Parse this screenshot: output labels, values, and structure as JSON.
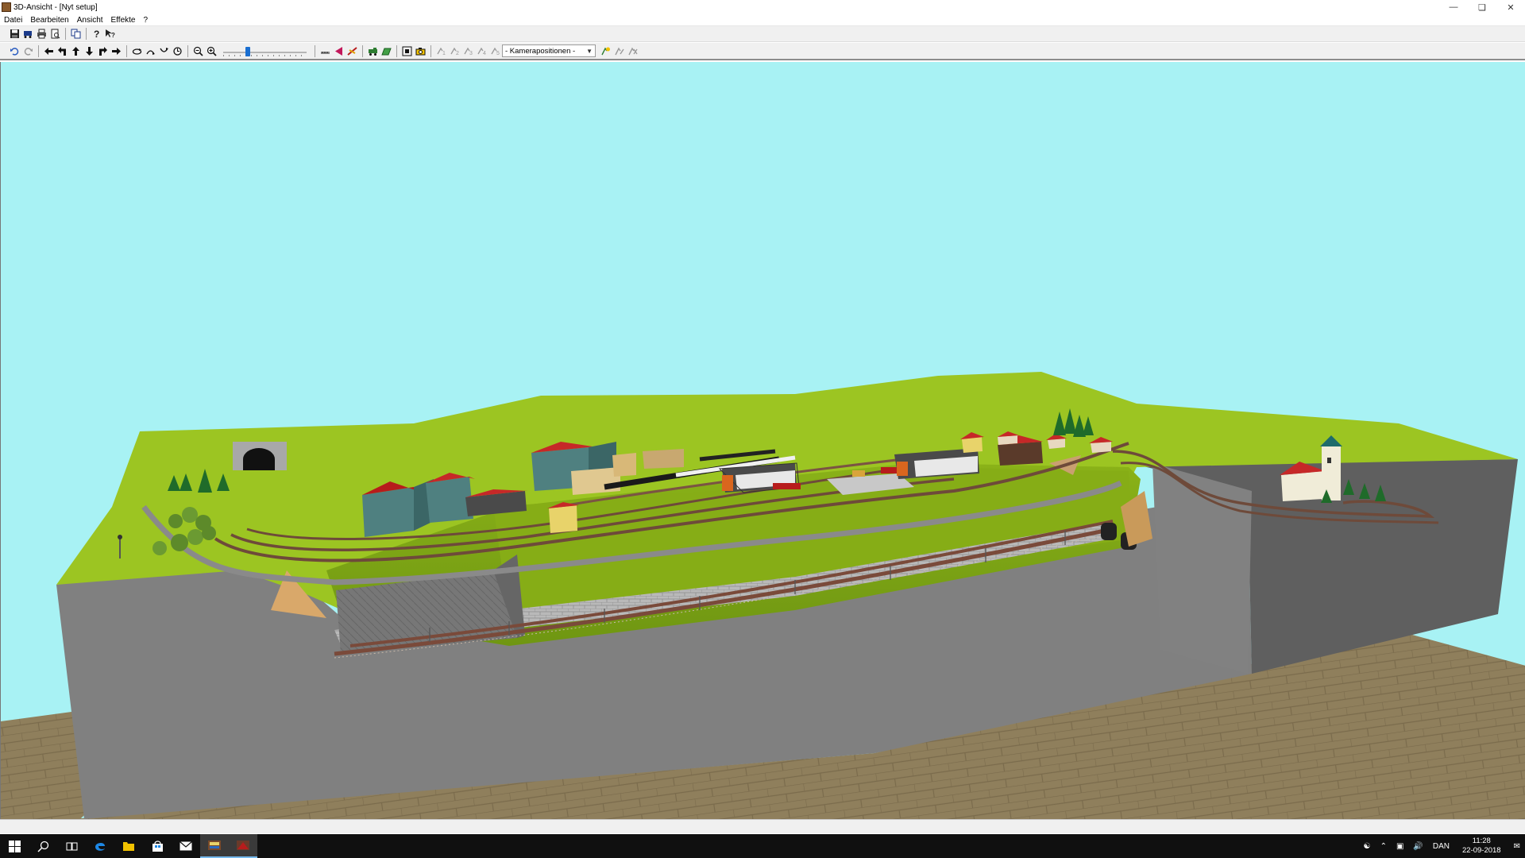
{
  "window": {
    "title": "3D-Ansicht - [Nyt setup]"
  },
  "menu": {
    "items": [
      "Datei",
      "Bearbeiten",
      "Ansicht",
      "Effekte",
      "?"
    ]
  },
  "toolbar": {
    "camera_combo": "- Kamerapositionen -",
    "zoom_slider_value": 0.28
  },
  "icons": {
    "save": "save-icon",
    "print": "print-icon",
    "help": "help-icon",
    "undo": "undo-icon",
    "redo": "redo-icon",
    "zoom_out": "zoom-out-icon",
    "zoom_in": "zoom-in-icon"
  },
  "colors": {
    "sky": "#a8f2f4",
    "grass": "#9cc522",
    "grass_dark": "#7ea214",
    "cliff": "#808080",
    "cliff_dark": "#5f5f5f",
    "floor": "#8f7f5c",
    "slider_thumb": "#1a6fd1"
  },
  "taskbar": {
    "language": "DAN",
    "time": "11:28",
    "date": "22-09-2018"
  }
}
